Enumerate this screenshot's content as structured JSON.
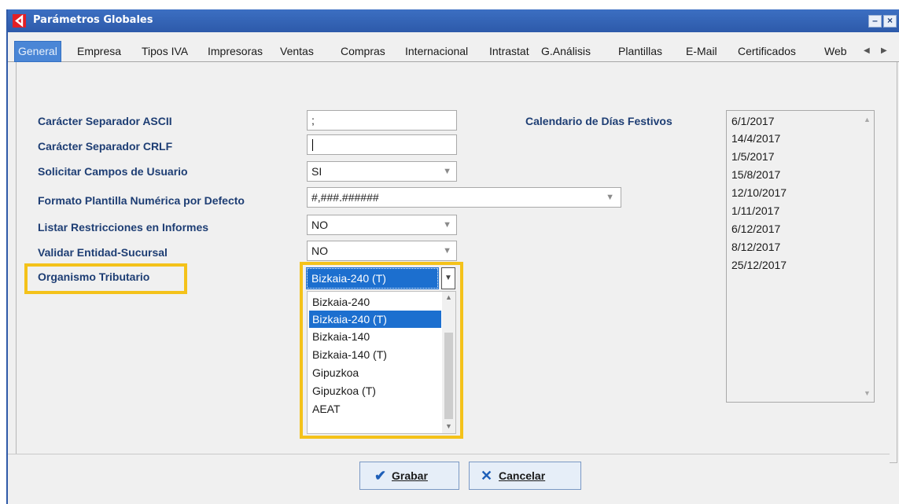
{
  "window": {
    "title": "Parámetros Globales",
    "minimize_label": "–",
    "close_label": "×"
  },
  "tabs": [
    "General",
    "Empresa",
    "Tipos IVA",
    "Impresoras",
    "Ventas",
    "Compras",
    "Internacional",
    "Intrastat",
    "G.Análisis",
    "Plantillas",
    "E-Mail",
    "Certificados",
    "Web"
  ],
  "tab_scroll": {
    "left": "◀",
    "right": "▶"
  },
  "fields": {
    "separador_ascii": {
      "label": "Carácter Separador ASCII",
      "value": ";"
    },
    "separador_crlf": {
      "label": "Carácter Separador CRLF",
      "value": ""
    },
    "campos_usuario": {
      "label": "Solicitar Campos de Usuario",
      "value": "SI"
    },
    "formato_plantilla": {
      "label": "Formato Plantilla Numérica por Defecto",
      "value": "#,###.######"
    },
    "listar_restricciones": {
      "label": "Listar Restricciones en Informes",
      "value": "NO"
    },
    "validar_entidad": {
      "label": "Validar Entidad-Sucursal",
      "value": "NO"
    },
    "organismo": {
      "label": "Organismo Tributario",
      "value": "Bizkaia-240 (T)"
    }
  },
  "dropdown_options": [
    "Bizkaia-240",
    "Bizkaia-240 (T)",
    "Bizkaia-140",
    "Bizkaia-140 (T)",
    "Gipuzkoa",
    "Gipuzkoa (T)",
    "AEAT"
  ],
  "calendar": {
    "label": "Calendario de Días Festivos",
    "dates": [
      "6/1/2017",
      "14/4/2017",
      "1/5/2017",
      "15/8/2017",
      "12/10/2017",
      "1/11/2017",
      "6/12/2017",
      "8/12/2017",
      "25/12/2017"
    ]
  },
  "buttons": {
    "save": "Grabar",
    "cancel": "Cancelar"
  },
  "icons": {
    "dropdown": "chevron-down-icon",
    "save": "check-icon",
    "cancel": "x-icon",
    "app": "app-logo-icon"
  },
  "colors": {
    "titlebar": "#2d5aaa",
    "highlight": "#f4c21a",
    "selection": "#1c6fcf",
    "label": "#1e3e74"
  }
}
